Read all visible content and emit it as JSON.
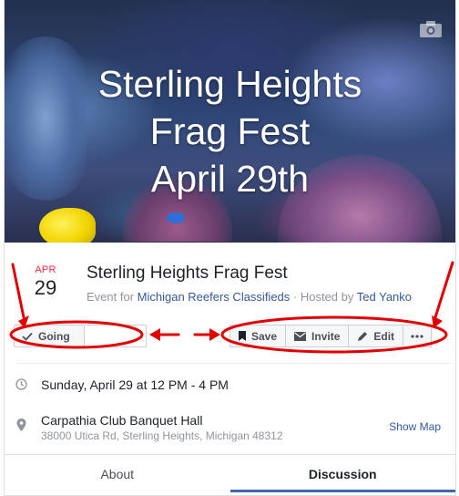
{
  "cover": {
    "title_lines": [
      "Sterling Heights",
      "Frag Fest",
      "April 29th"
    ]
  },
  "event": {
    "month": "APR",
    "day": "29",
    "title": "Sterling Heights Frag Fest",
    "event_for_label": "Event for",
    "group_name": "Michigan Reefers Classifieds",
    "separator": " · ",
    "hosted_by_label": "Hosted by",
    "host_name": "Ted Yanko"
  },
  "actions": {
    "going_label": "Going",
    "save_label": "Save",
    "invite_label": "Invite",
    "edit_label": "Edit"
  },
  "details": {
    "when": "Sunday, April 29 at 12 PM - 4 PM",
    "venue": "Carpathia Club Banquet Hall",
    "address": "38000 Utica Rd, Sterling Heights, Michigan 48312",
    "show_map_label": "Show Map"
  },
  "tabs": [
    {
      "label": "About",
      "active": false
    },
    {
      "label": "Discussion",
      "active": true
    }
  ],
  "colors": {
    "accent": "#4267b2",
    "link": "#365899",
    "month_red": "#f02849",
    "annotation_red": "#e00000"
  },
  "icons": [
    "camera-icon",
    "check-icon",
    "bookmark-icon",
    "envelope-icon",
    "pencil-icon",
    "more-icon",
    "clock-icon",
    "location-pin-icon"
  ]
}
